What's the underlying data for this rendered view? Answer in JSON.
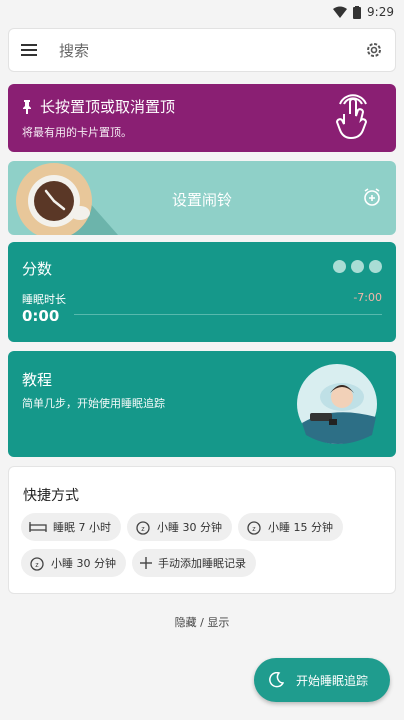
{
  "status": {
    "time": "9:29"
  },
  "search": {
    "placeholder": "搜索"
  },
  "pin_card": {
    "title": "长按置顶或取消置顶",
    "subtitle": "将最有用的卡片置顶。"
  },
  "alarm_card": {
    "label": "设置闹铃"
  },
  "score_card": {
    "title": "分数",
    "duration_label": "睡眠时长",
    "duration_value": "0:00",
    "diff": "-7:00"
  },
  "tutorial_card": {
    "title": "教程",
    "subtitle": "简单几步，开始使用睡眠追踪"
  },
  "shortcuts": {
    "title": "快捷方式",
    "items": [
      {
        "label": "睡眠 7 小时",
        "icon": "bed-icon"
      },
      {
        "label": "小睡 30 分钟",
        "icon": "nap-alarm-icon"
      },
      {
        "label": "小睡 15 分钟",
        "icon": "nap-alarm-icon"
      },
      {
        "label": "小睡 30 分钟",
        "icon": "nap-alarm-icon"
      },
      {
        "label": "手动添加睡眠记录",
        "icon": "plus-icon"
      }
    ]
  },
  "toggle": {
    "label": "隐藏 / 显示"
  },
  "fab": {
    "label": "开始睡眠追踪"
  },
  "colors": {
    "pin": "#8a1f73",
    "alarm": "#8fd0c8",
    "teal": "#15988a",
    "fab": "#1f9c8e"
  }
}
